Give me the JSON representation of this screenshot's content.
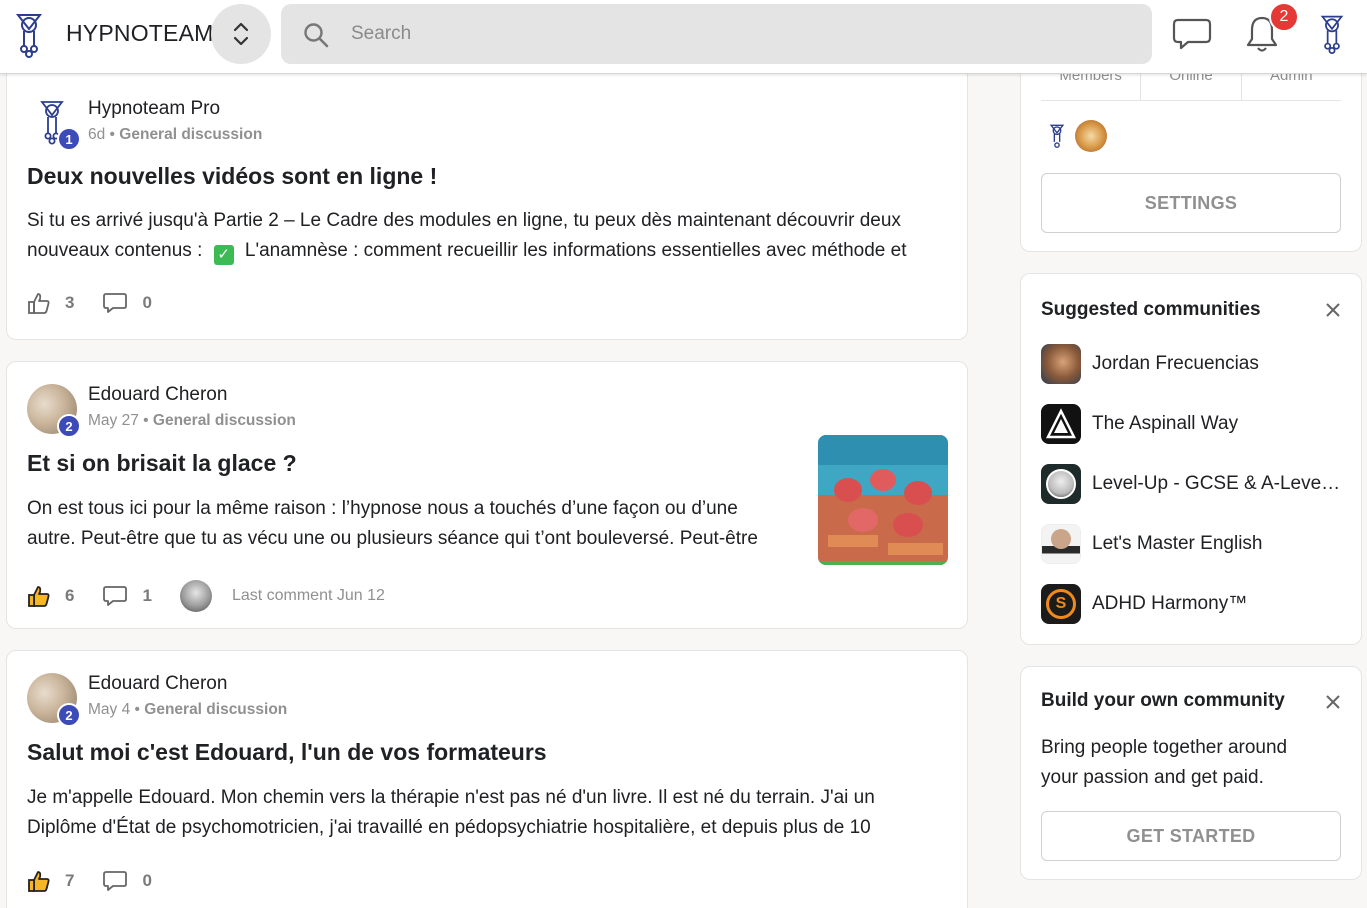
{
  "header": {
    "brand": "HYPNOTEAM",
    "search_placeholder": "Search",
    "notification_count": "2",
    "icons": [
      "hypnoteam-logo-icon",
      "chevron-up-down-icon",
      "search-icon",
      "chat-icon",
      "bell-icon",
      "user-avatar-icon"
    ]
  },
  "posts": [
    {
      "author": "Hypnoteam Pro",
      "level": "1",
      "time": "6d",
      "category": "General discussion",
      "title": "Deux nouvelles vidéos sont en ligne !",
      "body_line1": "Si tu es arrivé jusqu'à Partie 2 – Le Cadre des modules en ligne, tu peux dès maintenant découvrir deux",
      "body_line2_pre": "nouveaux contenus :",
      "body_line2_post": "L'anamnèse : comment recueillir les informations essentielles avec méthode et",
      "likes": "3",
      "comments": "0"
    },
    {
      "author": "Edouard Cheron",
      "level": "2",
      "time": "May 27",
      "category": "General discussion",
      "title": "Et si on brisait la glace ?",
      "body_line1": "On est tous ici pour la même raison : l’hypnose nous a touchés d’une façon ou d’une",
      "body_line2": "autre. Peut-être que tu as vécu une ou plusieurs séance qui t’ont bouleversé. Peut-être",
      "likes": "6",
      "comments": "1",
      "last_comment": "Last comment Jun 12"
    },
    {
      "author": "Edouard Cheron",
      "level": "2",
      "time": "May 4",
      "category": "General discussion",
      "title": "Salut moi c'est Edouard, l'un de vos formateurs",
      "body_line1": "Je m'appelle Edouard. Mon chemin vers la thérapie n'est pas né d'un livre. Il est né du terrain. J'ai un",
      "body_line2": "Diplôme d'État de psychomotricien, j'ai travaillé en pédopsychiatrie hospitalière, et depuis plus de 10",
      "likes": "7",
      "comments": "0"
    }
  ],
  "about_card": {
    "stats_labels": [
      "Members",
      "Online",
      "Admin"
    ],
    "settings_label": "SETTINGS"
  },
  "suggested": {
    "title": "Suggested communities",
    "items": [
      {
        "name": "Jordan Frecuencias",
        "color": "#8a5a3a"
      },
      {
        "name": "The Aspinall Way",
        "color": "#111111"
      },
      {
        "name": "Level-Up - GCSE & A-Level ...",
        "color": "#1f2a2a"
      },
      {
        "name": "Let's Master English",
        "color": "#ffffff"
      },
      {
        "name": "ADHD Harmony™",
        "color": "#1b1b1b"
      }
    ]
  },
  "build": {
    "title": "Build your own community",
    "body_line1": "Bring people together around",
    "body_line2": "your passion and get paid.",
    "button": "GET STARTED"
  },
  "colors": {
    "accent_badge": "#3d4bb8",
    "notification_red": "#e53935",
    "logo_blue": "#2c3e8c"
  }
}
